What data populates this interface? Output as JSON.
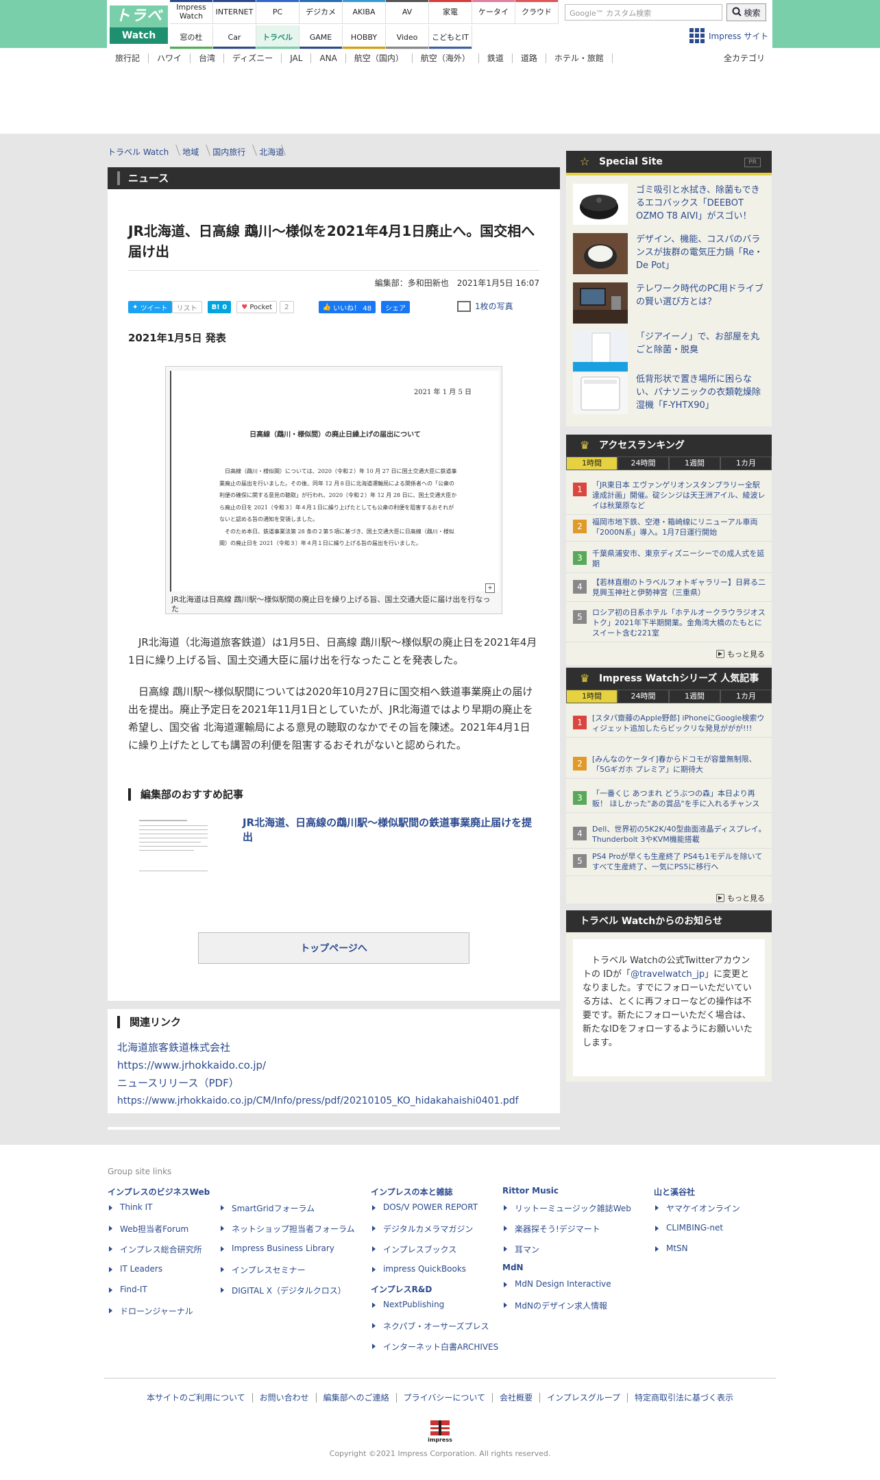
{
  "header": {
    "logo_top": "トラベル",
    "logo_bottom": "Watch",
    "nav_row1": [
      "Impress Watch",
      "INTERNET",
      "PC",
      "デジカメ",
      "AKIBA",
      "AV",
      "家電",
      "ケータイ",
      "クラウド"
    ],
    "nav_row2": [
      "窓の杜",
      "Car",
      "トラベル",
      "GAME",
      "HOBBY",
      "Video",
      "こどもとIT"
    ],
    "nav_colors_row1": [
      "#2b4a8e",
      "#2b4a8e",
      "#3366cc",
      "#2a6db0",
      "#3a9ad9",
      "#555555",
      "#d63c3c",
      "#e080a0",
      "#e05555"
    ],
    "nav_colors_row2": [
      "#4caf50",
      "#2b4a8e",
      "#78cfaa",
      "#2b4a8e",
      "#d8a000",
      "#888888",
      "#3a5ea8"
    ],
    "search_placeholder": "Google™ カスタム検索",
    "search_button": "検索",
    "impress_site": "Impress サイト"
  },
  "subnav": [
    "旅行記",
    "ハワイ",
    "台湾",
    "ディズニー",
    "JAL",
    "ANA",
    "航空（国内）",
    "航空（海外）",
    "鉄道",
    "道路",
    "ホテル・旅館"
  ],
  "all_category": "全カテゴリ",
  "breadcrumb": [
    "トラベル Watch",
    "地域",
    "国内旅行",
    "北海道"
  ],
  "article": {
    "section": "ニュース",
    "title": "JR北海道、日高線 鵡川～様似を2021年4月1日廃止へ。国交相へ届け出",
    "byline": "編集部：多和田新也　2021年1月5日 16:07",
    "social": {
      "tweet": "ツイート",
      "list": "リスト",
      "hatena": "B! 0",
      "pocket": "Pocket",
      "pocket_count": "2",
      "like": "いいね！ 48",
      "share": "シェア"
    },
    "photo_count": "1枚の写真",
    "date": "2021年1月5日 発表",
    "doc_date": "2021 年 1 月 5 日",
    "doc_title": "日高線（鵡川・様似間）の廃止日繰上げの届出について",
    "doc_body_1": "日高線（鵡川・様似間）については、2020（令和２）年 10 月 27 日に国土交通大臣に鉄道事業廃止の届出を行いました。その後、同年 12 月８日に北海道運輸局による関係者への「公衆の利便の確保に関する意見の聴取」が行われ、2020（令和２）年 12 月 28 日に、国土交通大臣から廃止の日を 2021（令和３）年４月１日に繰り上げたとしても公衆の利便を阻害するおそれがないと認める旨の通知を受領しました。",
    "doc_body_2": "そのため本日、鉄道事業法第 28 条の２第５項に基づき、国土交通大臣に日高線（鵡川・様似間）の廃止日を 2021（令和３）年４月１日に繰り上げる旨の届出を行いました。",
    "caption": "JR北海道は日高線 鵡川駅～様似駅間の廃止日を繰り上げる旨、国土交通大臣に届け出を行なった",
    "para1": "JR北海道（北海道旅客鉄道）は1月5日、日高線 鵡川駅～様似駅の廃止日を2021年4月1日に繰り上げる旨、国土交通大臣に届け出を行なったことを発表した。",
    "para2": "日高線 鵡川駅～様似駅間については2020年10月27日に国交相へ鉄道事業廃止の届け出を提出。廃止予定日を2021年11月1日としていたが、JR北海道ではより早期の廃止を希望し、国交省 北海道運輸局による意見の聴取のなかでその旨を陳述。2021年4月1日に繰り上げたとしても講習の利便を阻害するおそれがないと認められた。",
    "reco_header": "編集部のおすすめ記事",
    "reco_link": "JR北海道、日高線の鵡川駅～様似駅間の鉄道事業廃止届けを提出",
    "top_button": "トップページへ"
  },
  "related": {
    "header": "関連リンク",
    "links": [
      "北海道旅客鉄道株式会社",
      "https://www.jrhokkaido.co.jp/",
      "ニュースリリース（PDF）",
      "https://www.jrhokkaido.co.jp/CM/Info/press/pdf/20210105_KO_hidakahaishi0401.pdf"
    ]
  },
  "special": {
    "header": "Special Site",
    "pr": "PR",
    "items": [
      "ゴミ吸引と水拭き、除菌もできるエコバックス「DEEBOT OZMO T8 AIVI」がスゴい！",
      "デザイン、機能、コスパのバランスが抜群の電気圧力鍋「Re・De Pot」",
      "テレワーク時代のPC用ドライブの賢い選び方とは？",
      "「ジアイーノ」で、お部屋を丸ごと除菌・脱臭",
      "低背形状で置き場所に困らない、パナソニックの衣類乾燥除湿機「F-YHTX90」"
    ]
  },
  "ranking": {
    "header": "アクセスランキング",
    "tabs": [
      "1時間",
      "24時間",
      "1週間",
      "1カ月"
    ],
    "items": [
      "「JR東日本 エヴァンゲリオンスタンプラリー全駅達成計画」開催。碇シンジは天王洲アイル、綾波レイは秋葉原など",
      "福岡市地下鉄、空港・箱崎線にリニューアル車両「2000N系」導入。1月7日運行開始",
      "千葉県浦安市、東京ディズニーシーでの成人式を延期",
      "【若林直樹のトラベルフォトギャラリー】日昇る二見興玉神社と伊勢神宮（三重県）",
      "ロシア初の日系ホテル「ホテルオークラウラジオストク」2021年下半期開業。金角湾大橋のたもとにスイート含む221室"
    ],
    "more": "もっと見る"
  },
  "impress_ranking": {
    "header": "Impress Watchシリーズ 人気記事",
    "tabs": [
      "1時間",
      "24時間",
      "1週間",
      "1カ月"
    ],
    "items": [
      "[スタパ齋藤のApple野郎] iPhoneにGoogle検索ウィジェット追加したらビックリな発見ががが!!!",
      "[みんなのケータイ]春からドコモが容量無制限、「5Gギガホ プレミア」に期待大",
      "「一番くじ あつまれ どうぶつの森」本日より再販！ ほしかった\"あの賞品\"を手に入れるチャンス",
      "Dell、世界初の5K2K/40型曲面液晶ディスプレイ。Thunderbolt 3やKVM機能搭載",
      "PS4 Proが早くも生産終了 PS4も1モデルを除いてすべて生産終了、一気にPS5に移行へ"
    ],
    "more": "もっと見る"
  },
  "notice": {
    "header": "トラベル Watchからのお知らせ",
    "text_before": "トラベル Watchの公式Twitterアカウントの IDが「",
    "handle": "@travelwatch_jp",
    "text_after": "」に変更となりました。すでにフォローいただいている方は、とくに再フォローなどの操作は不要です。新たにフォローいただく場合は、新たなIDをフォローするようにお願いいたします。"
  },
  "rank_colors": [
    "#d9453f",
    "#e09a2a",
    "#5aa85a",
    "#888888",
    "#888888"
  ],
  "footer": {
    "group_label": "Group site links",
    "col1_header": "インプレスのビジネスWeb",
    "col1a": [
      "Think IT",
      "Web担当者Forum",
      "インプレス総合研究所",
      "IT Leaders",
      "Find-IT",
      "ドローンジャーナル"
    ],
    "col1b": [
      "SmartGridフォーラム",
      "ネットショップ担当者フォーラム",
      "Impress Business Library",
      "インプレスセミナー",
      "DIGITAL X（デジタルクロス）"
    ],
    "col2_header": "インプレスの本と雑誌",
    "col2": [
      "DOS/V POWER REPORT",
      "デジタルカメラマガジン",
      "インプレスブックス",
      "impress QuickBooks"
    ],
    "col2b_header": "インプレスR&D",
    "col2b": [
      "NextPublishing",
      "ネクパブ・オーサーズプレス",
      "インターネット白書ARCHIVES"
    ],
    "col3_header": "Rittor Music",
    "col3": [
      "リットーミュージック雑誌Web",
      "楽器探そう!デジマート",
      "耳マン"
    ],
    "col3b_header": "MdN",
    "col3b": [
      "MdN Design Interactive",
      "MdNのデザイン求人情報"
    ],
    "col4_header": "山と溪谷社",
    "col4": [
      "ヤマケイオンライン",
      "CLIMBING-net",
      "MtSN"
    ],
    "links": [
      "本サイトのご利用について",
      "お問い合わせ",
      "編集部へのご連絡",
      "プライバシーについて",
      "会社概要",
      "インプレスグループ",
      "特定商取引法に基づく表示"
    ],
    "logo_text": "impress",
    "copyright": "Copyright ©2021  Impress Corporation. All rights reserved."
  }
}
